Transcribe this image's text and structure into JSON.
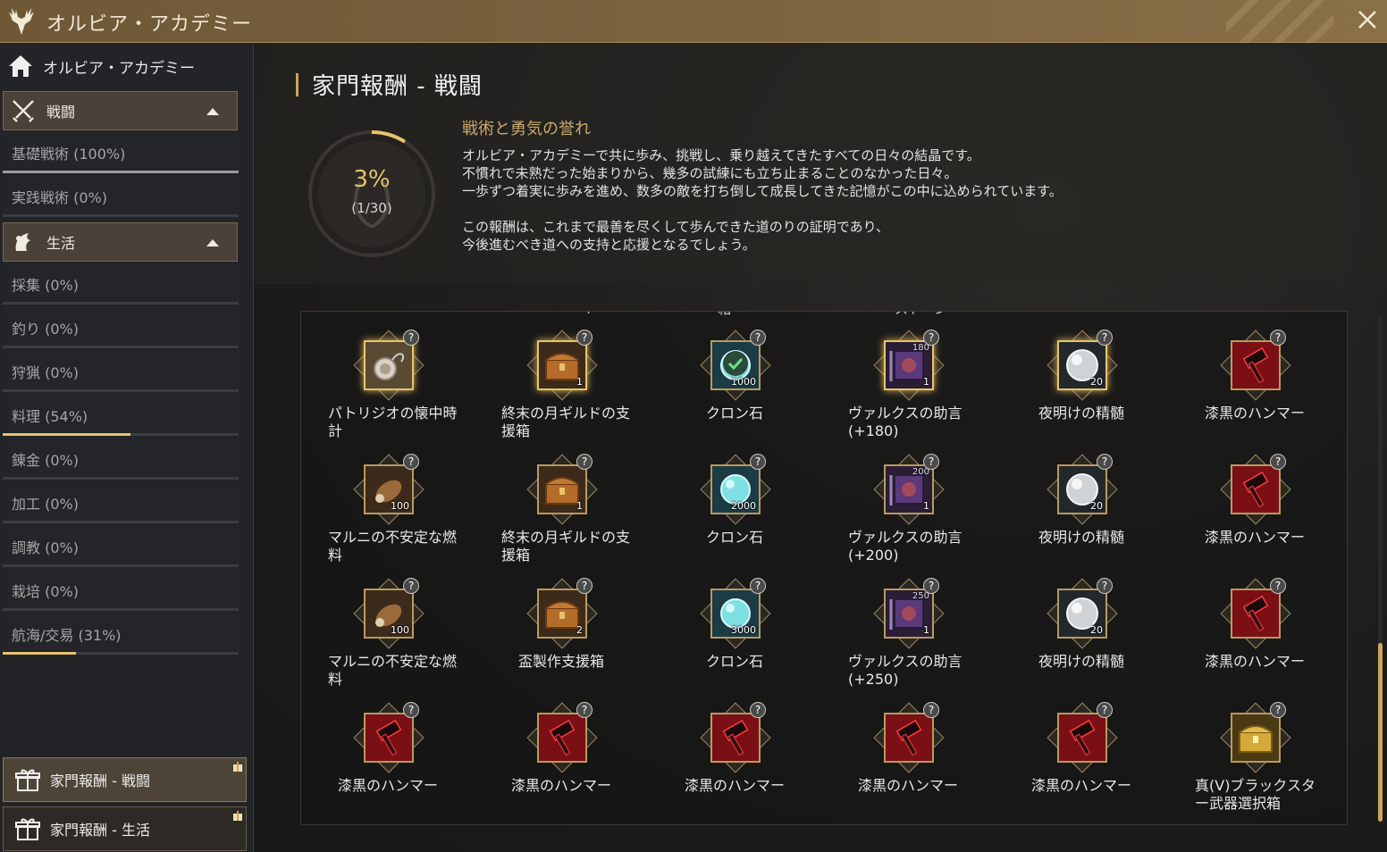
{
  "window": {
    "title": "オルビア・アカデミー"
  },
  "sidebar": {
    "home_label": "オルビア・アカデミー",
    "categories": [
      {
        "label": "戦闘",
        "subs": [
          {
            "label": "基礎戦術 (100%)",
            "progress": 100
          },
          {
            "label": "実践戦術 (0%)",
            "progress": 0
          }
        ]
      },
      {
        "label": "生活",
        "subs": [
          {
            "label": "採集 (0%)",
            "progress": 0
          },
          {
            "label": "釣り (0%)",
            "progress": 0
          },
          {
            "label": "狩猟 (0%)",
            "progress": 0
          },
          {
            "label": "料理 (54%)",
            "progress": 54
          },
          {
            "label": "錬金 (0%)",
            "progress": 0
          },
          {
            "label": "加工 (0%)",
            "progress": 0
          },
          {
            "label": "調教 (0%)",
            "progress": 0
          },
          {
            "label": "栽培 (0%)",
            "progress": 0
          },
          {
            "label": "航海/交易 (31%)",
            "progress": 31
          }
        ]
      }
    ],
    "reward_buttons": [
      "家門報酬 - 戦闘",
      "家門報酬 - 生活"
    ]
  },
  "main": {
    "title": "家門報酬 - 戦闘",
    "progress_percent": "3%",
    "progress_count": "(1/30)",
    "progress_value": 3,
    "subtitle": "戦術と勇気の誉れ",
    "description": [
      "オルビア・アカデミーで共に歩み、挑戦し、乗り越えてきたすべての日々の結晶です。",
      "不慣れで未熟だった始まりから、幾多の試練にも立ち止まることのなかった日々。",
      "一歩ずつ着実に歩みを進め、数多の敵を打ち倒して成長してきた記憶がこの中に込められています。",
      "",
      "この報酬は、これまで最善を尽くして歩んできた道のりの証明であり、",
      "今後進むべき道への支持と応援となるでしょう。"
    ],
    "cut_labels": [
      "武器選択箱",
      "+150)",
      "箱",
      "ストーン"
    ],
    "items": [
      [
        {
          "name": "パトリジオの懐中時計",
          "icon": "pocket-watch-icon",
          "qty": "",
          "gold": true
        },
        {
          "name": "終末の月ギルドの支援箱",
          "icon": "chest-icon",
          "qty": "1",
          "gold": true
        },
        {
          "name": "クロン石",
          "icon": "cron-stone-icon",
          "qty": "1000",
          "check": true
        },
        {
          "name": "ヴァルクスの助言(+180)",
          "icon": "scroll-icon",
          "qty": "1",
          "qty_top": "180",
          "gold": true
        },
        {
          "name": "夜明けの精髄",
          "icon": "dawn-essence-icon",
          "qty": "20",
          "gold": true
        },
        {
          "name": "漆黒のハンマー",
          "icon": "black-hammer-icon",
          "qty": ""
        }
      ],
      [
        {
          "name": "マルニの不安定な燃料",
          "icon": "fuel-icon",
          "qty": "100"
        },
        {
          "name": "終末の月ギルドの支援箱",
          "icon": "chest-icon",
          "qty": "1"
        },
        {
          "name": "クロン石",
          "icon": "cron-stone-icon",
          "qty": "2000"
        },
        {
          "name": "ヴァルクスの助言(+200)",
          "icon": "scroll-icon",
          "qty": "1",
          "qty_top": "200"
        },
        {
          "name": "夜明けの精髄",
          "icon": "dawn-essence-icon",
          "qty": "20"
        },
        {
          "name": "漆黒のハンマー",
          "icon": "black-hammer-icon",
          "qty": ""
        }
      ],
      [
        {
          "name": "マルニの不安定な燃料",
          "icon": "fuel-icon",
          "qty": "100"
        },
        {
          "name": "盃製作支援箱",
          "icon": "chest-icon",
          "qty": "2"
        },
        {
          "name": "クロン石",
          "icon": "cron-stone-icon",
          "qty": "3000"
        },
        {
          "name": "ヴァルクスの助言(+250)",
          "icon": "scroll-icon",
          "qty": "1",
          "qty_top": "250"
        },
        {
          "name": "夜明けの精髄",
          "icon": "dawn-essence-icon",
          "qty": "20"
        },
        {
          "name": "漆黒のハンマー",
          "icon": "black-hammer-icon",
          "qty": ""
        }
      ],
      [
        {
          "name": "漆黒のハンマー",
          "icon": "black-hammer-icon",
          "qty": ""
        },
        {
          "name": "漆黒のハンマー",
          "icon": "black-hammer-icon",
          "qty": ""
        },
        {
          "name": "漆黒のハンマー",
          "icon": "black-hammer-icon",
          "qty": ""
        },
        {
          "name": "漆黒のハンマー",
          "icon": "black-hammer-icon",
          "qty": ""
        },
        {
          "name": "漆黒のハンマー",
          "icon": "black-hammer-icon",
          "qty": ""
        },
        {
          "name": "真(V)ブラックスター武器選択箱",
          "icon": "gold-chest-icon",
          "qty": ""
        }
      ]
    ]
  }
}
